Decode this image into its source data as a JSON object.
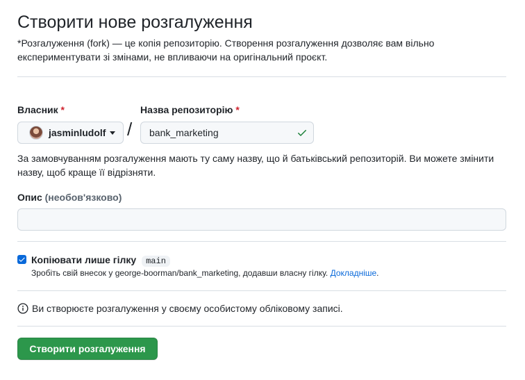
{
  "page": {
    "title": "Створити нове розгалуження",
    "intro": "*Розгалуження (fork) — це копія репозиторію. Створення розгалуження дозволяє вам вільно експериментувати зі змінами, не впливаючи на оригінальний проєкт."
  },
  "owner": {
    "label": "Власник",
    "required_mark": "*",
    "value": "jasminludolf",
    "avatar_icon": "user-avatar",
    "caret_icon": "triangle-down-icon"
  },
  "separator": "/",
  "repo": {
    "label": "Назва репозиторію",
    "required_mark": "*",
    "value": "bank_marketing",
    "valid_icon": "check-icon",
    "valid_color": "#1a7f37"
  },
  "name_hint": "За замовчуванням розгалуження мають ту саму назву, що й батьківський репозиторій. Ви можете змінити назву, щоб краще її відрізняти.",
  "description": {
    "label": "Опис",
    "optional": "(необов'язково)",
    "value": ""
  },
  "copy_branch": {
    "checked": true,
    "label": "Копіювати лише гілку",
    "branch": "main",
    "note": "Зробіть свій внесок у george-boorman/bank_marketing, додавши власну гілку.",
    "link": "Докладніше",
    "note_end": "."
  },
  "info": {
    "icon": "info-icon",
    "text": "Ви створюєте розгалуження у своєму особистому обліковому записі."
  },
  "submit": {
    "label": "Створити розгалуження",
    "color": "#2c974b"
  }
}
